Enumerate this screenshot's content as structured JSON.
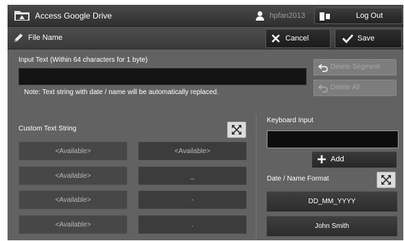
{
  "topbar": {
    "title": "Access Google Drive",
    "user": "hpfan2013",
    "logout_label": "Log Out"
  },
  "subbar": {
    "title": "File Name",
    "cancel_label": "Cancel",
    "save_label": "Save"
  },
  "input": {
    "instruction": "Input Text (Within 64 characters for 1 byte)",
    "value": "",
    "note": "Note: Text string with date / name will be automatically replaced."
  },
  "actions": {
    "delete_segment_label": "Delete Segment",
    "delete_all_label": "Delete All"
  },
  "custom": {
    "title": "Custom Text String",
    "left": [
      "<Available>",
      "<Available>",
      "<Available>",
      "<Available>"
    ],
    "right": [
      "<Available>",
      "_",
      "-",
      "."
    ]
  },
  "keyboard": {
    "title": "Keyboard Input",
    "value": "",
    "add_label": "Add"
  },
  "date_format": {
    "title": "Date / Name Format",
    "options": [
      "DD_MM_YYYY",
      "John Smith"
    ]
  },
  "icons": {
    "drive": "drive-folder-icon",
    "user": "user-icon",
    "logout": "logout-icon",
    "pencil": "pencil-icon",
    "cancel": "x-icon",
    "save": "check-icon",
    "undo": "undo-icon",
    "clear": "clear-icon",
    "expand": "expand-icon",
    "add": "plus-icon"
  },
  "colors": {
    "background": "#626262",
    "bar": "#3a3a3a",
    "field": "#141414",
    "disabled": "#7d7d7d"
  }
}
